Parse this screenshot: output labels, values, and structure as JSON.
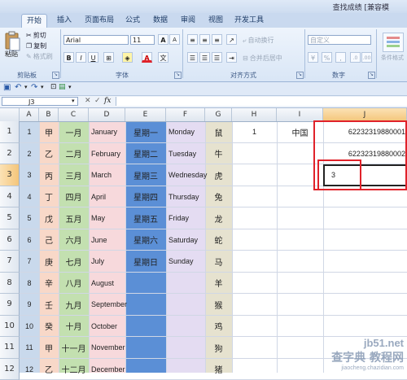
{
  "title": "查找成绩 [兼容模",
  "tabs": [
    {
      "label": "开始",
      "active": true
    },
    {
      "label": "插入"
    },
    {
      "label": "页面布局"
    },
    {
      "label": "公式"
    },
    {
      "label": "数据"
    },
    {
      "label": "审阅"
    },
    {
      "label": "视图"
    },
    {
      "label": "开发工具"
    }
  ],
  "ribbon": {
    "paste": "粘贴",
    "cut": "剪切",
    "copy": "复制",
    "format_painter": "格式刷",
    "font_name": "Arial",
    "font_size": "11",
    "grow_font": "A",
    "shrink_font": "A",
    "bold": "B",
    "italic": "I",
    "underline": "U",
    "font_color_letter": "A",
    "wrap_text": "自动换行",
    "merge_center": "合并后居中",
    "number_format": "自定义",
    "currency": "¥",
    "percent": "%",
    "comma": ",",
    "cond_format": "条件格式",
    "groups": {
      "clipboard": "剪贴板",
      "font": "字体",
      "alignment": "对齐方式",
      "number": "数字"
    }
  },
  "formula_bar": {
    "name_box": "J3",
    "fx": "fx"
  },
  "columns": [
    "A",
    "B",
    "C",
    "D",
    "E",
    "F",
    "G",
    "H",
    "I",
    "J"
  ],
  "rows": [
    {
      "num": "1",
      "A": "1",
      "B": "甲",
      "C": "一月",
      "D": "January",
      "E": "星期一",
      "F": "Monday",
      "G": "鼠",
      "H": "1",
      "I": "中国",
      "J": "62232319880001"
    },
    {
      "num": "2",
      "A": "2",
      "B": "乙",
      "C": "二月",
      "D": "February",
      "E": "星期二",
      "F": "Tuesday",
      "G": "牛",
      "H": "",
      "I": "",
      "J": "62232319880002"
    },
    {
      "num": "3",
      "A": "3",
      "B": "丙",
      "C": "三月",
      "D": "March",
      "E": "星期三",
      "F": "Wednesday",
      "G": "虎",
      "H": "",
      "I": "",
      "J": "3"
    },
    {
      "num": "4",
      "A": "4",
      "B": "丁",
      "C": "四月",
      "D": "April",
      "E": "星期四",
      "F": "Thursday",
      "G": "兔",
      "H": "",
      "I": "",
      "J": ""
    },
    {
      "num": "5",
      "A": "5",
      "B": "戊",
      "C": "五月",
      "D": "May",
      "E": "星期五",
      "F": "Friday",
      "G": "龙",
      "H": "",
      "I": "",
      "J": ""
    },
    {
      "num": "6",
      "A": "6",
      "B": "己",
      "C": "六月",
      "D": "June",
      "E": "星期六",
      "F": "Saturday",
      "G": "蛇",
      "H": "",
      "I": "",
      "J": ""
    },
    {
      "num": "7",
      "A": "7",
      "B": "庚",
      "C": "七月",
      "D": "July",
      "E": "星期日",
      "F": "Sunday",
      "G": "马",
      "H": "",
      "I": "",
      "J": ""
    },
    {
      "num": "8",
      "A": "8",
      "B": "辛",
      "C": "八月",
      "D": "August",
      "E": "",
      "F": "",
      "G": "羊",
      "H": "",
      "I": "",
      "J": ""
    },
    {
      "num": "9",
      "A": "9",
      "B": "壬",
      "C": "九月",
      "D": "September",
      "E": "",
      "F": "",
      "G": "猴",
      "H": "",
      "I": "",
      "J": ""
    },
    {
      "num": "10",
      "A": "10",
      "B": "癸",
      "C": "十月",
      "D": "October",
      "E": "",
      "F": "",
      "G": "鸡",
      "H": "",
      "I": "",
      "J": ""
    },
    {
      "num": "11",
      "A": "11",
      "B": "甲",
      "C": "十一月",
      "D": "November",
      "E": "",
      "F": "",
      "G": "狗",
      "H": "",
      "I": "",
      "J": ""
    },
    {
      "num": "12",
      "A": "12",
      "B": "乙",
      "C": "十二月",
      "D": "December",
      "E": "",
      "F": "",
      "G": "猪",
      "H": "",
      "I": "",
      "J": ""
    }
  ],
  "column_colors": {
    "A": "#c9d9ec",
    "B": "#f8d8c8",
    "C": "#c3e0b0",
    "D": "#f7d9dc",
    "E": "#5b8fd6",
    "F": "#e4dcf2",
    "G": "#e6e2cf"
  },
  "highlight_color": "#e0222a",
  "watermark": {
    "line1": "jb51.net",
    "line2": "查字典 教程网",
    "line3": "jiaocheng.chazidian.com"
  }
}
